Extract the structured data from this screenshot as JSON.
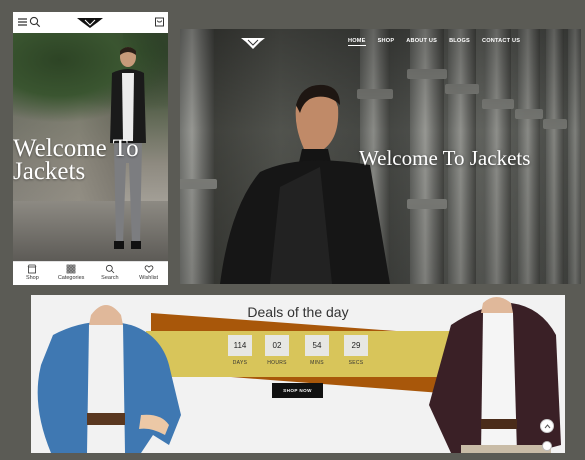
{
  "mobile": {
    "hero_title_line1": "Welcome To",
    "hero_title_line2": "Jackets",
    "nav": [
      {
        "label": "Shop",
        "icon": "store-icon"
      },
      {
        "label": "Categories",
        "icon": "grid-icon"
      },
      {
        "label": "Search",
        "icon": "search-icon"
      },
      {
        "label": "Wishlist",
        "icon": "heart-icon"
      }
    ]
  },
  "desktop": {
    "menu": [
      "HOME",
      "SHOP",
      "ABOUT US",
      "BLOGS",
      "CONTACT US"
    ],
    "active_menu": "HOME",
    "hero_title": "Welcome To Jackets"
  },
  "deals": {
    "title": "Deals of the day",
    "countdown": [
      {
        "value": "114",
        "label": "DAYS"
      },
      {
        "value": "02",
        "label": "HOURS"
      },
      {
        "value": "54",
        "label": "MINS"
      },
      {
        "value": "29",
        "label": "SECS"
      }
    ],
    "button_label": "SHOP NOW"
  },
  "colors": {
    "background": "#5b5b55",
    "banner_yellow": "#d8c55a",
    "banner_orange": "#a8570a",
    "button_black": "#111111"
  }
}
